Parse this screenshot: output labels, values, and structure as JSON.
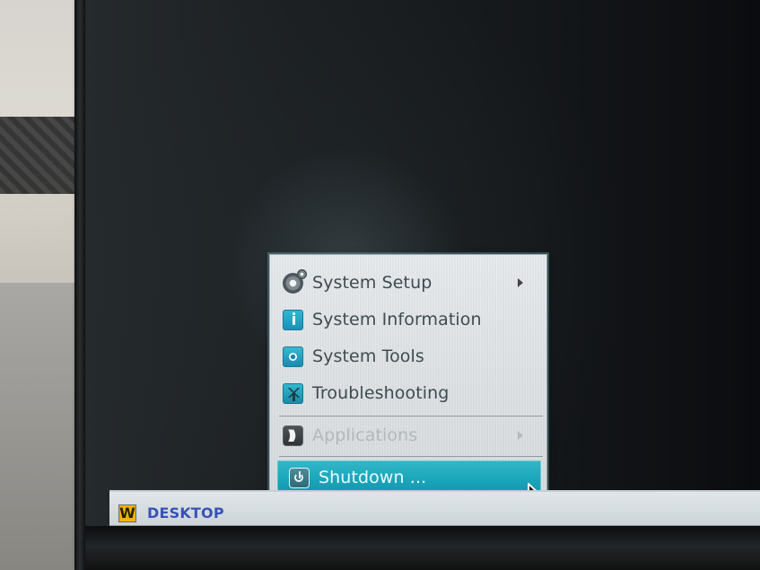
{
  "menu": {
    "items": [
      {
        "label": "System Setup",
        "icon": "gear-icon",
        "has_submenu": true,
        "enabled": true
      },
      {
        "label": "System Information",
        "icon": "info-icon",
        "has_submenu": false,
        "enabled": true
      },
      {
        "label": "System Tools",
        "icon": "system-tools-icon",
        "has_submenu": false,
        "enabled": true
      },
      {
        "label": "Troubleshooting",
        "icon": "troubleshooting-icon",
        "has_submenu": false,
        "enabled": true
      },
      {
        "label": "Applications",
        "icon": "applications-icon",
        "has_submenu": true,
        "enabled": false
      },
      {
        "label": "Shutdown ...",
        "icon": "power-icon",
        "has_submenu": false,
        "enabled": true,
        "selected": true
      }
    ],
    "colors": {
      "highlight": "#1aa6bb",
      "text": "#3f4b52",
      "disabled_text": "#b2b8bc"
    }
  },
  "taskbar": {
    "start_label": "DESKTOP",
    "logo_text": "W",
    "logo_color": "#f0b400"
  }
}
